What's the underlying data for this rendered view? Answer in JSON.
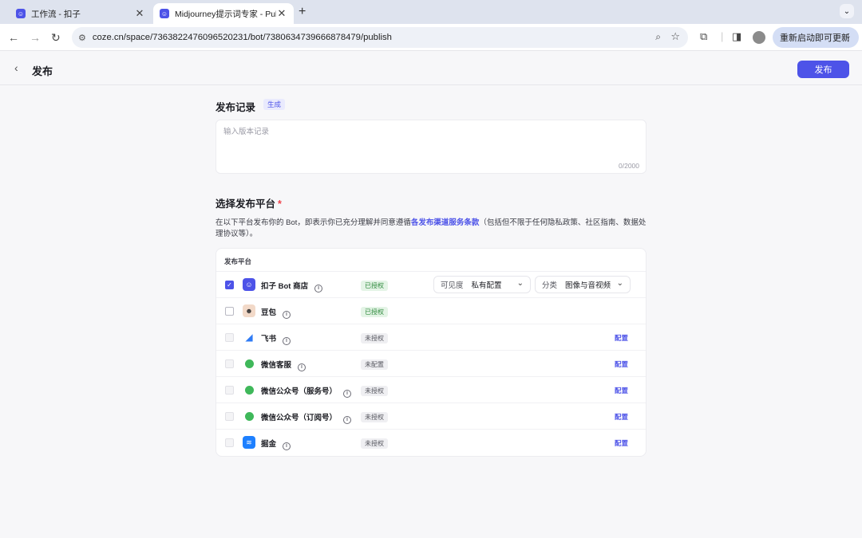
{
  "browser": {
    "tabs": [
      {
        "title": "工作流 - 扣子",
        "active": false
      },
      {
        "title": "Midjourney提示词专家 - Publis",
        "active": true
      }
    ],
    "url": "coze.cn/space/7363822476096520231/bot/7380634739666878479/publish",
    "update_label": "重新启动即可更新"
  },
  "header": {
    "title": "发布",
    "publish_label": "发布"
  },
  "release_notes": {
    "title": "发布记录",
    "generate_tag": "生成",
    "placeholder": "输入版本记录",
    "counter": "0/2000"
  },
  "platforms_section": {
    "title": "选择发布平台",
    "required_mark": "*",
    "desc_before": "在以下平台发布你的 Bot，即表示你已充分理解并同意遵循",
    "desc_link": "各发布渠道服务条款",
    "desc_after": "（包括但不限于任何隐私政策、社区指南、数据处理协议等）。",
    "table_header": "发布平台",
    "rows": [
      {
        "name": "扣子 Bot 商店",
        "status": "已授权",
        "status_type": "authorized",
        "checked": true,
        "icon": "coze-icon",
        "icon_color": "#4d53e8",
        "visibility_label": "可见度",
        "visibility_value": "私有配置",
        "category_label": "分类",
        "category_value": "图像与音视频"
      },
      {
        "name": "豆包",
        "status": "已授权",
        "status_type": "authorized",
        "checked": false,
        "icon": "doubao-icon",
        "icon_color": "#f2d9c8"
      },
      {
        "name": "飞书",
        "status": "未授权",
        "status_type": "unauthorized",
        "checked": false,
        "disabled": true,
        "icon": "feishu-icon",
        "icon_color": "#2f7bf5",
        "action": "配置"
      },
      {
        "name": "微信客服",
        "status": "未配置",
        "status_type": "unconfigured",
        "checked": false,
        "disabled": true,
        "icon": "wechat-icon",
        "icon_color": "#3fb85a",
        "action": "配置"
      },
      {
        "name": "微信公众号（服务号）",
        "status": "未授权",
        "status_type": "unauthorized",
        "checked": false,
        "disabled": true,
        "icon": "wechat-icon",
        "icon_color": "#3fb85a",
        "action": "配置"
      },
      {
        "name": "微信公众号（订阅号）",
        "status": "未授权",
        "status_type": "unauthorized",
        "checked": false,
        "disabled": true,
        "icon": "wechat-icon",
        "icon_color": "#3fb85a",
        "action": "配置"
      },
      {
        "name": "掘金",
        "status": "未授权",
        "status_type": "unauthorized",
        "checked": false,
        "disabled": true,
        "icon": "juejin-icon",
        "icon_color": "#1e80ff",
        "action": "配置"
      }
    ]
  },
  "colors": {
    "primary": "#4d53e8",
    "required": "#f0424b"
  }
}
